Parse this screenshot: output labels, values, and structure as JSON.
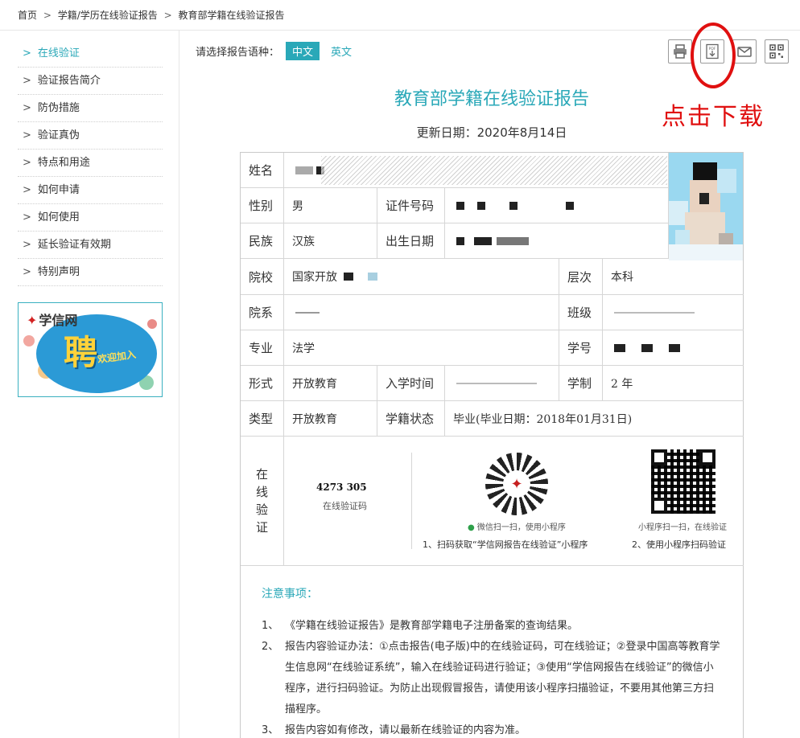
{
  "breadcrumb": [
    "首页",
    "学籍/学历在线验证报告",
    "教育部学籍在线验证报告"
  ],
  "breadcrumb_sep": ">",
  "sidebar": {
    "items": [
      {
        "label": "在线验证",
        "active": true
      },
      {
        "label": "验证报告简介"
      },
      {
        "label": "防伪措施"
      },
      {
        "label": "验证真伪"
      },
      {
        "label": "特点和用途"
      },
      {
        "label": "如何申请"
      },
      {
        "label": "如何使用"
      },
      {
        "label": "延长验证有效期"
      },
      {
        "label": "特别声明"
      }
    ],
    "arrow": ">"
  },
  "ad": {
    "logo": "学信网",
    "big": "聘",
    "small": "欢迎加入"
  },
  "lang": {
    "prompt": "请选择报告语种：",
    "cn": "中文",
    "en": "英文"
  },
  "annotation": {
    "download": "点击下载"
  },
  "report": {
    "title": "教育部学籍在线验证报告",
    "update": "更新日期：2020年8月14日",
    "fields": {
      "name_label": "姓名",
      "gender_label": "性别",
      "gender_value": "男",
      "id_label": "证件号码",
      "ethnic_label": "民族",
      "ethnic_value": "汉族",
      "birth_label": "出生日期",
      "school_label": "院校",
      "school_value": "国家开放",
      "level_label": "层次",
      "level_value": "本科",
      "dept_label": "院系",
      "class_label": "班级",
      "major_label": "专业",
      "major_value": "法学",
      "stuno_label": "学号",
      "form_label": "形式",
      "form_value": "开放教育",
      "enroll_label": "入学时间",
      "length_label": "学制",
      "length_value": "2 年",
      "type_label": "类型",
      "type_value": "开放教育",
      "status_label": "学籍状态",
      "status_value": "毕业(毕业日期：2018年01月31日)"
    },
    "verify": {
      "label": "在线验证",
      "code": "4273 305",
      "code_label": "在线验证码",
      "wx_caption": "微信扫一扫，使用小程序",
      "mini_caption": "小程序扫一扫，在线验证",
      "step1": "1、扫码获取“学信网报告在线验证”小程序",
      "step2": "2、使用小程序扫码验证"
    },
    "notes": {
      "title": "注意事项：",
      "items": [
        {
          "n": "1、",
          "text": "《学籍在线验证报告》是教育部学籍电子注册备案的查询结果。"
        },
        {
          "n": "2、",
          "text": "报告内容验证办法：①点击报告(电子版)中的在线验证码，可在线验证；②登录中国高等教育学生信息网“在线验证系统”，输入在线验证码进行验证；③使用“学信网报告在线验证”的微信小程序，进行扫码验证。为防止出现假冒报告，请使用该小程序扫描验证，不要用其他第三方扫描程序。"
        },
        {
          "n": "3、",
          "text": "报告内容如有修改，请以最新在线验证的内容为准。"
        }
      ]
    }
  },
  "tools": [
    {
      "name": "print-icon"
    },
    {
      "name": "pdf-download-icon"
    },
    {
      "name": "mail-icon"
    },
    {
      "name": "qrcode-icon"
    }
  ],
  "colors": {
    "accent": "#2aa8b8",
    "annotation": "#e01010"
  }
}
